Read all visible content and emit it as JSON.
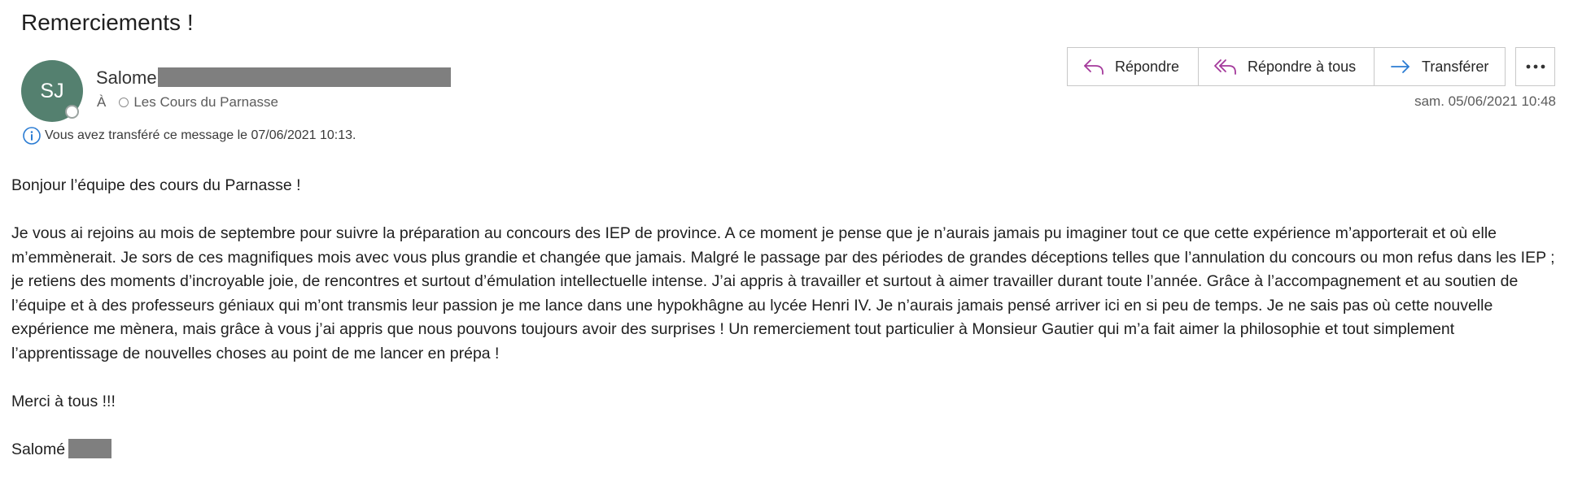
{
  "email": {
    "subject": "Remerciements !",
    "sender": {
      "initials": "SJ",
      "name": "Salome"
    },
    "to": {
      "prefix": "À",
      "recipient": "Les Cours du Parnasse"
    },
    "info": "Vous avez transféré ce message le 07/06/2021 10:13.",
    "date": "sam. 05/06/2021 10:48",
    "body": {
      "greeting": "Bonjour l’équipe des cours du Parnasse !",
      "paragraph": "Je vous ai rejoins au mois de septembre pour suivre la préparation au concours des IEP de province. A ce moment je pense que je n’aurais jamais pu imaginer tout ce que cette expérience m’apporterait et où elle m’emmènerait. Je sors de ces magnifiques mois avec vous plus grandie et changée que jamais. Malgré le passage par des périodes de grandes déceptions telles que l’annulation du concours ou mon refus dans les IEP ; je retiens des moments d’incroyable joie, de rencontres et surtout d’émulation intellectuelle intense. J’ai appris à travailler et surtout à aimer travailler durant toute l’année. Grâce à l’accompagnement et au soutien de l’équipe et à des professeurs géniaux qui m’ont transmis leur passion je me lance dans une hypokhâgne au lycée Henri IV. Je n’aurais jamais pensé arriver ici en si peu de temps. Je ne sais pas où cette nouvelle expérience me mènera, mais grâce à vous j’ai appris que nous pouvons toujours avoir des surprises ! Un remerciement tout particulier à Monsieur Gautier qui m’a fait aimer la philosophie et tout simplement l’apprentissage de nouvelles choses au point de me lancer en prépa !",
      "thanks": "Merci à tous !!!",
      "signature": "Salomé"
    }
  },
  "actions": {
    "reply": "Répondre",
    "reply_all": "Répondre à tous",
    "forward": "Transférer"
  },
  "colors": {
    "avatar": "#54806f",
    "reply_icon": "#a4399b",
    "forward_icon": "#2b7cd3",
    "info_icon": "#2b7cd3"
  },
  "icons": {
    "reply": "reply-arrow-icon",
    "reply_all": "reply-all-arrow-icon",
    "forward": "forward-arrow-icon",
    "more": "more-ellipsis-icon",
    "info": "info-circle-icon"
  }
}
